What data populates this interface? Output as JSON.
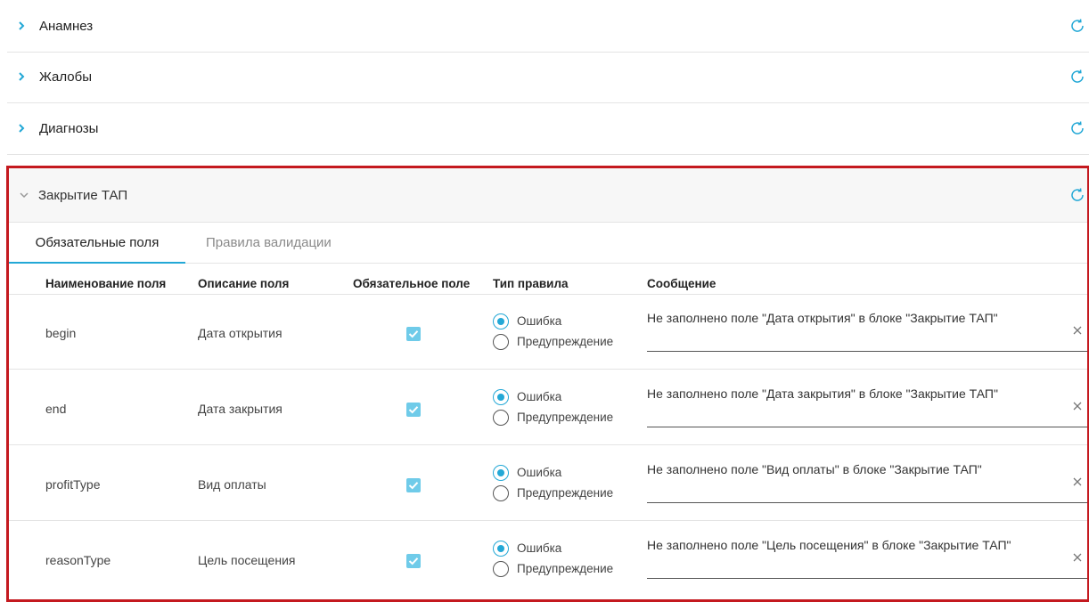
{
  "sections": [
    {
      "title": "Анамнез",
      "expanded": false
    },
    {
      "title": "Жалобы",
      "expanded": false
    },
    {
      "title": "Диагнозы",
      "expanded": false
    }
  ],
  "open_section": {
    "title": "Закрытие ТАП",
    "expanded": true
  },
  "tabs": [
    {
      "label": "Обязательные поля",
      "active": true
    },
    {
      "label": "Правила валидации",
      "active": false
    }
  ],
  "columns": [
    "Наименование поля",
    "Описание поля",
    "Обязательное поле",
    "Тип правила",
    "Сообщение"
  ],
  "radio_options": [
    "Ошибка",
    "Предупреждение"
  ],
  "rows": [
    {
      "name": "begin",
      "description": "Дата открытия",
      "required": true,
      "rule_type": "Ошибка",
      "message": "Не заполнено поле \"Дата открытия\" в блоке \"Закрытие ТАП\""
    },
    {
      "name": "end",
      "description": "Дата закрытия",
      "required": true,
      "rule_type": "Ошибка",
      "message": "Не заполнено поле \"Дата закрытия\" в блоке \"Закрытие ТАП\""
    },
    {
      "name": "profitType",
      "description": "Вид оплаты",
      "required": true,
      "rule_type": "Ошибка",
      "message": "Не заполнено поле \"Вид оплаты\" в блоке \"Закрытие ТАП\""
    },
    {
      "name": "reasonType",
      "description": "Цель посещения",
      "required": true,
      "rule_type": "Ошибка",
      "message": "Не заполнено поле \"Цель посещения\" в блоке \"Закрытие ТАП\""
    }
  ],
  "colors": {
    "accent": "#23a8d6",
    "checkbox": "#6fcbe9",
    "highlight": "#c4191f"
  },
  "icons": {
    "expand": "chevron-right-icon",
    "collapse": "chevron-down-icon",
    "refresh": "refresh-icon",
    "clear": "close-icon"
  }
}
